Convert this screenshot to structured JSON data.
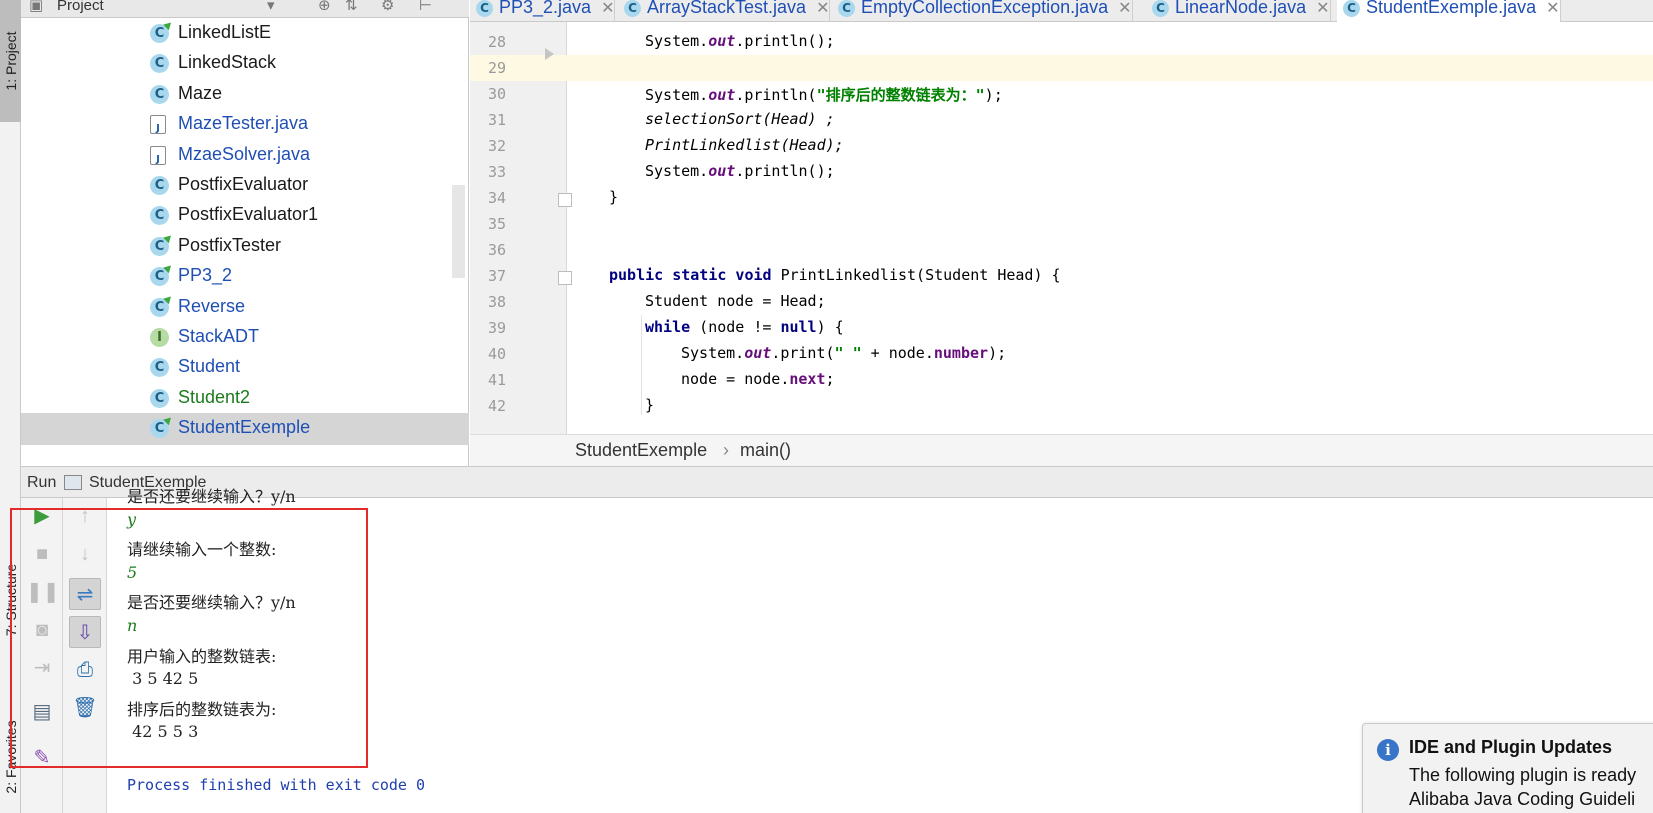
{
  "side_tabs": {
    "project": "1: Project",
    "structure": "7: Structure",
    "favorites": "2: Favorites"
  },
  "project_panel": {
    "title": "Project",
    "items": [
      {
        "label": "LinkedListE",
        "icon": "class-run-icon",
        "color": "black"
      },
      {
        "label": "LinkedStack",
        "icon": "class-icon",
        "color": "black"
      },
      {
        "label": "Maze",
        "icon": "class-icon",
        "color": "black"
      },
      {
        "label": "MazeTester.java",
        "icon": "java-file-icon",
        "color": "blue"
      },
      {
        "label": "MzaeSolver.java",
        "icon": "java-file-icon",
        "color": "blue"
      },
      {
        "label": "PostfixEvaluator",
        "icon": "class-icon",
        "color": "black"
      },
      {
        "label": "PostfixEvaluator1",
        "icon": "class-icon",
        "color": "black"
      },
      {
        "label": "PostfixTester",
        "icon": "class-run-icon",
        "color": "black"
      },
      {
        "label": "PP3_2",
        "icon": "class-run-icon",
        "color": "blue"
      },
      {
        "label": "Reverse",
        "icon": "class-run-icon",
        "color": "blue"
      },
      {
        "label": "StackADT",
        "icon": "interface-icon",
        "color": "blue"
      },
      {
        "label": "Student",
        "icon": "class-icon",
        "color": "blue"
      },
      {
        "label": "Student2",
        "icon": "class-icon",
        "color": "green"
      },
      {
        "label": "StudentExemple",
        "icon": "class-run-icon",
        "color": "blue",
        "selected": true
      }
    ]
  },
  "editor_tabs": [
    {
      "label": "PP3_2.java"
    },
    {
      "label": "ArrayStackTest.java"
    },
    {
      "label": "EmptyCollectionException.java"
    },
    {
      "label": "LinearNode.java"
    },
    {
      "label": "StudentExemple.java",
      "active": true
    }
  ],
  "code": {
    "line_numbers": [
      "28",
      "29",
      "30",
      "31",
      "32",
      "33",
      "34",
      "35",
      "36",
      "37",
      "38",
      "39",
      "40",
      "41",
      "42"
    ],
    "l28": "System.out.println();",
    "l30_str": "\"排序后的整数链表为：\"",
    "l31": "selectionSort(Head) ;",
    "l32": "PrintLinkedlist(Head);",
    "l37_sig": "PrintLinkedlist(Student Head) {",
    "l38": "Student node = Head;",
    "l40_str": "\" \"",
    "l41": "node = node.next;"
  },
  "breadcrumb": {
    "class": "StudentExemple",
    "method": "main()"
  },
  "run_panel": {
    "label": "Run",
    "config": "StudentExemple",
    "console": [
      {
        "text": "是否还要继续输入？y/n",
        "kind": "out"
      },
      {
        "text": "y",
        "kind": "input"
      },
      {
        "text": "请继续输入一个整数:",
        "kind": "out"
      },
      {
        "text": "5",
        "kind": "input"
      },
      {
        "text": "是否还要继续输入？y/n",
        "kind": "out"
      },
      {
        "text": "n",
        "kind": "input"
      },
      {
        "text": "用户输入的整数链表:",
        "kind": "out"
      },
      {
        "text": " 3 5 42 5",
        "kind": "out"
      },
      {
        "text": "排序后的整数链表为:",
        "kind": "out"
      },
      {
        "text": " 42 5 5 3",
        "kind": "out"
      },
      {
        "text": "",
        "kind": "out"
      },
      {
        "text": "Process finished with exit code 0",
        "kind": "proc"
      }
    ]
  },
  "notification": {
    "title": "IDE and Plugin Updates",
    "line1": "The following plugin is ready",
    "line2": "Alibaba Java Coding Guideli"
  }
}
